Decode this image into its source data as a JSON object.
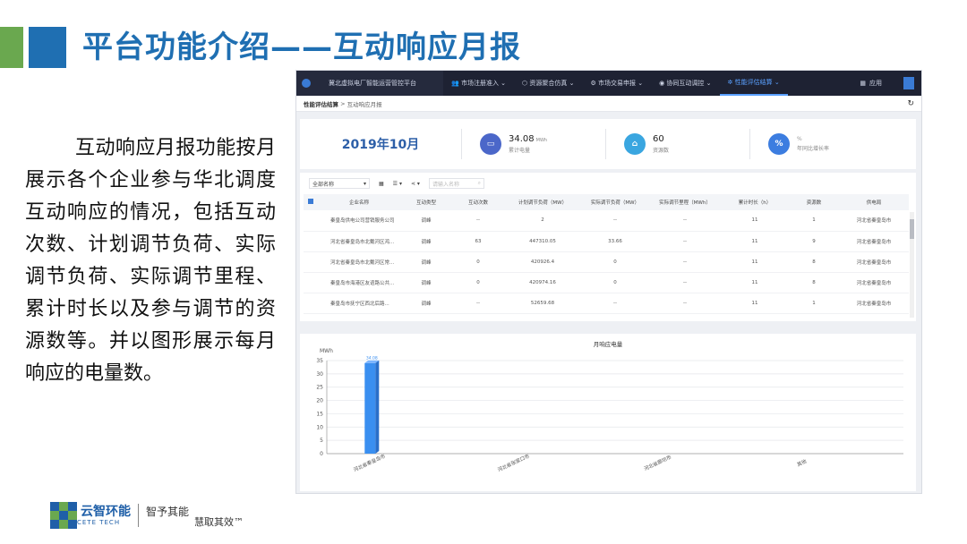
{
  "slide": {
    "title": "平台功能介绍——互动响应月报",
    "description": "互动响应月报功能按月展示各个企业参与华北调度互动响应的情况，包括互动次数、计划调节负荷、实际调节负荷、实际调节里程、累计时长以及参与调节的资源数等。并以图形展示每月响应的电量数。"
  },
  "logo": {
    "name_cn": "云智环能",
    "name_en": "CETE TECH",
    "slogan_1": "智予其能",
    "slogan_2": "慧取其效™"
  },
  "app": {
    "title": "冀北虚拟电厂智能运营管控平台",
    "nav": [
      {
        "label": "市场注册准入",
        "icon": "users-icon"
      },
      {
        "label": "资源聚合仿真",
        "icon": "cube-icon"
      },
      {
        "label": "市场交易申报",
        "icon": "trade-icon"
      },
      {
        "label": "协同互动调控",
        "icon": "eye-icon"
      },
      {
        "label": "性能评估结算",
        "icon": "gear-icon",
        "active": true
      }
    ],
    "apps_label": "应用",
    "breadcrumb": [
      "性能评估结算",
      "互动响应月报"
    ],
    "summary": {
      "month": "2019年10月",
      "energy_value": "34.08",
      "energy_unit": "MWh",
      "energy_label": "累计电量",
      "resources_value": "60",
      "resources_label": "资源数",
      "ratio_value": "",
      "ratio_unit": "%",
      "ratio_label": "年同比增长率"
    },
    "toolbar": {
      "select_placeholder": "全部名称",
      "search_placeholder": "请输入名称"
    },
    "table": {
      "columns": [
        "企业名称",
        "互动类型",
        "互动次数",
        "计划调节负荷（MW）",
        "实际调节负荷（MW）",
        "实际调节里程（MWh）",
        "累计时长（h）",
        "资源数",
        "供电局"
      ],
      "rows": [
        [
          "秦皇岛供电公司营销服务公司",
          "调峰",
          "--",
          "2",
          "--",
          "--",
          "11",
          "1",
          "河北省秦皇岛市"
        ],
        [
          "河北省秦皇岛市北戴河区鸿...",
          "调峰",
          "63",
          "447310.05",
          "33.66",
          "--",
          "11",
          "9",
          "河北省秦皇岛市"
        ],
        [
          "河北省秦皇岛市北戴河区常...",
          "调峰",
          "0",
          "420926.4",
          "0",
          "--",
          "11",
          "8",
          "河北省秦皇岛市"
        ],
        [
          "秦皇岛市海港区友谊路公共...",
          "调峰",
          "0",
          "420974.16",
          "0",
          "--",
          "11",
          "8",
          "河北省秦皇岛市"
        ],
        [
          "秦皇岛市抚宁区西北后路...",
          "调峰",
          "--",
          "52659.68",
          "--",
          "--",
          "11",
          "1",
          "河北省秦皇岛市"
        ]
      ]
    }
  },
  "chart_data": {
    "type": "bar",
    "title": "月响应电量",
    "ylabel": "MWh",
    "ylim": [
      0,
      35
    ],
    "yticks": [
      0,
      5,
      10,
      15,
      20,
      25,
      30,
      35
    ],
    "categories": [
      "河北省秦皇岛市",
      "河北省张家口市",
      "河北省廊坊市",
      "其他"
    ],
    "values": [
      34.08,
      0,
      0,
      0
    ],
    "data_labels": [
      "34.08",
      "",
      "",
      ""
    ],
    "bar_color": "#3a8ff0",
    "grid": true
  }
}
